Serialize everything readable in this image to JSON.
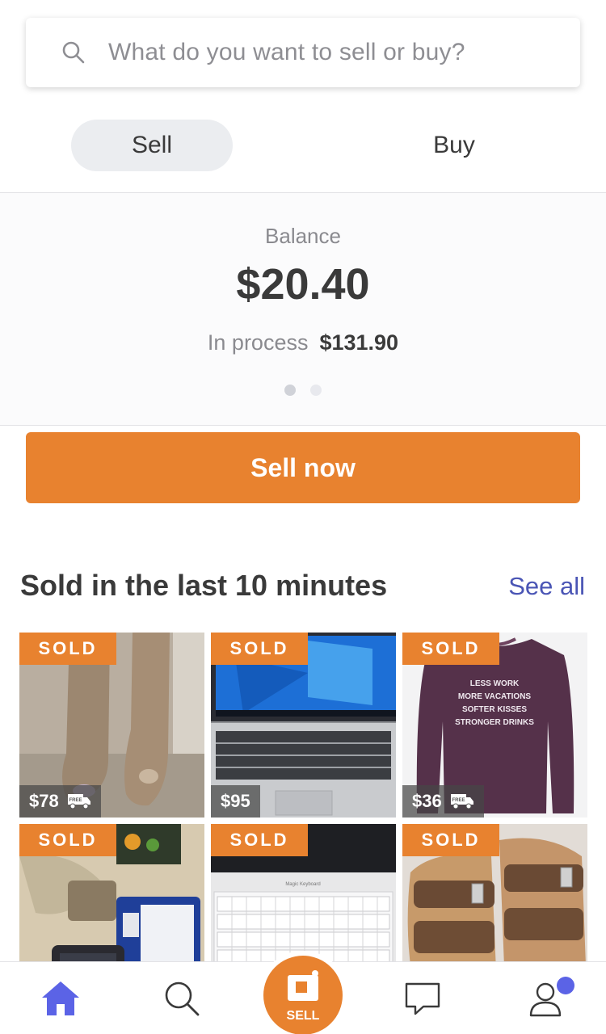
{
  "search": {
    "placeholder": "What do you want to sell or buy?",
    "icon": "search-icon"
  },
  "toggle": {
    "sell_label": "Sell",
    "buy_label": "Buy",
    "selected": "Sell"
  },
  "balance": {
    "label": "Balance",
    "amount": "$20.40",
    "in_process_label": "In process",
    "in_process_value": "$131.90",
    "page_index": 1,
    "page_count": 2
  },
  "sell_now": {
    "label": "Sell now"
  },
  "sold_section": {
    "title": "Sold in the last 10 minutes",
    "see_all": "See all",
    "items": [
      {
        "badge": "SOLD",
        "price": "$78",
        "free_shipping": true,
        "subject": "rain boots"
      },
      {
        "badge": "SOLD",
        "price": "$95",
        "free_shipping": false,
        "subject": "laptop"
      },
      {
        "badge": "SOLD",
        "price": "$36",
        "free_shipping": true,
        "subject": "sweatshirt",
        "shirt_text": [
          "LESS WORK",
          "MORE VACATIONS",
          "SOFTER KISSES",
          "STRONGER DRINKS"
        ]
      },
      {
        "badge": "SOLD",
        "price": "",
        "free_shipping": false,
        "subject": "game handheld"
      },
      {
        "badge": "SOLD",
        "price": "",
        "free_shipping": false,
        "subject": "keyboard",
        "label_text": "Magic Keyboard"
      },
      {
        "badge": "SOLD",
        "price": "",
        "free_shipping": false,
        "subject": "sandals"
      }
    ],
    "free_label": "FREE"
  },
  "bottom_nav": {
    "items": [
      {
        "name": "home",
        "icon": "home-icon",
        "active": true
      },
      {
        "name": "search",
        "icon": "search-icon"
      },
      {
        "name": "sell",
        "icon": "camera-tag-icon",
        "label": "SELL"
      },
      {
        "name": "messages",
        "icon": "chat-icon"
      },
      {
        "name": "profile",
        "icon": "user-icon",
        "has_notification": true
      }
    ]
  },
  "colors": {
    "accent": "#e8822f",
    "link": "#4a55b5",
    "active_nav": "#5b63e6",
    "notification": "#5b63e6"
  }
}
